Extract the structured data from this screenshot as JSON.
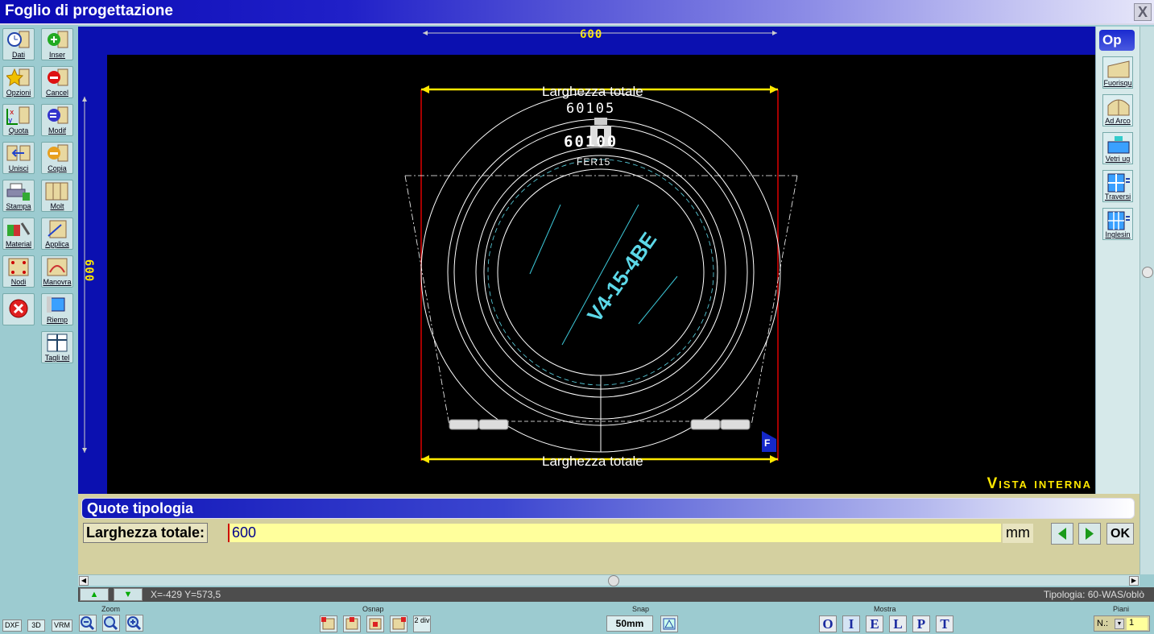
{
  "window": {
    "title": "Foglio di progettazione",
    "close": "X"
  },
  "left_tools": [
    {
      "label": "Dati",
      "icon": "clock-window-icon"
    },
    {
      "label": "Inser",
      "icon": "add-green-icon"
    },
    {
      "label": "Opzioni",
      "icon": "star-icon"
    },
    {
      "label": "Cancel",
      "icon": "remove-red-icon"
    },
    {
      "label": "Quota",
      "icon": "dimension-xy-icon"
    },
    {
      "label": "Modif",
      "icon": "edit-blue-icon"
    },
    {
      "label": "Unisci",
      "icon": "merge-icon"
    },
    {
      "label": "Copia",
      "icon": "copy-orange-icon"
    },
    {
      "label": "Stampa",
      "icon": "printer-icon"
    },
    {
      "label": "Molt",
      "icon": "multiply-frames-icon"
    },
    {
      "label": "Material",
      "icon": "materials-icon"
    },
    {
      "label": "Applica",
      "icon": "apply-icon"
    },
    {
      "label": "Nodi",
      "icon": "nodes-icon"
    },
    {
      "label": "Manovra",
      "icon": "maneuver-icon"
    },
    {
      "label": "",
      "icon": "close-circle-icon"
    },
    {
      "label": "Riemp",
      "icon": "fill-icon"
    },
    {
      "label": "Tagli tel",
      "icon": "frame-cuts-icon"
    }
  ],
  "right_tools": {
    "tab": "Op",
    "items": [
      {
        "label": "Fuorisqu",
        "icon": "out-of-square-icon"
      },
      {
        "label": "Ad Arco",
        "icon": "arch-icon"
      },
      {
        "label": "Vetri ug",
        "icon": "glass-ug-icon"
      },
      {
        "label": "Traversi",
        "icon": "transoms-icon"
      },
      {
        "label": "Inglesin",
        "icon": "grid-bars-icon"
      }
    ]
  },
  "drawing": {
    "dim_top": "600",
    "dim_left": "600",
    "width_label_top": "Larghezza totale",
    "width_label_bottom": "Larghezza totale",
    "profile_code_1": "60105",
    "profile_code_2": "60100",
    "hardware_code": "FER15",
    "glass_code": "V4-15-4BE",
    "f_marker": "F",
    "view_label": "Vista interna"
  },
  "quote_panel": {
    "header": "Quote tipologia",
    "field_label": "Larghezza totale:",
    "field_value": "600",
    "unit": "mm",
    "ok_label": "OK"
  },
  "status": {
    "coords": "X=-429  Y=573,5",
    "tipologia": "Tipologia: 60-WAS/oblò"
  },
  "bottom": {
    "formats": [
      "DXF",
      "3D",
      "VRM"
    ],
    "zoom_label": "Zoom",
    "osnap_label": "Osnap",
    "osnap_div": "2 div",
    "snap_label": "Snap",
    "snap_value": "50mm",
    "mostra_label": "Mostra",
    "mostra_buttons": [
      "O",
      "I",
      "E",
      "L",
      "P",
      "T"
    ],
    "piani_label": "Piani",
    "piani_n": "N.:",
    "piani_value": "1"
  },
  "colors": {
    "title_blue": "#0a0ab4",
    "canvas": "#000000",
    "dim_yellow": "#ffe800",
    "input_yellow": "#ffff9c"
  }
}
